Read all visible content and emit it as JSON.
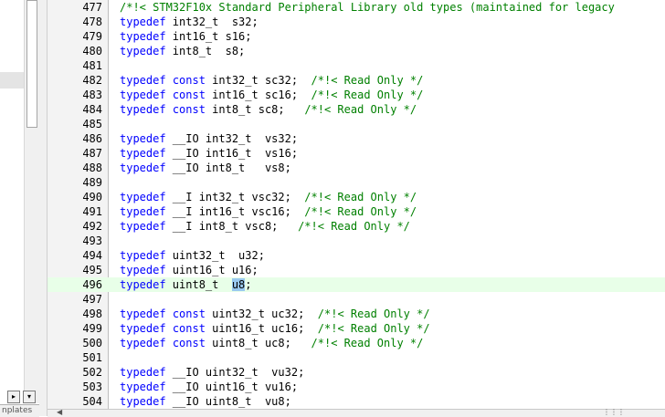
{
  "left_panel": {
    "tab_label": "nplates"
  },
  "editor": {
    "current_line": 496,
    "selected_word": "u8",
    "lines": [
      {
        "n": "477",
        "segs": [
          {
            "c": "cm",
            "t": "/*!< STM32F10x Standard Peripheral Library old types (maintained for legacy"
          }
        ]
      },
      {
        "n": "478",
        "segs": [
          {
            "c": "kw",
            "t": "typedef"
          },
          {
            "c": "",
            "t": " int32_t  s32;"
          }
        ]
      },
      {
        "n": "479",
        "segs": [
          {
            "c": "kw",
            "t": "typedef"
          },
          {
            "c": "",
            "t": " int16_t s16;"
          }
        ]
      },
      {
        "n": "480",
        "segs": [
          {
            "c": "kw",
            "t": "typedef"
          },
          {
            "c": "",
            "t": " int8_t  s8;"
          }
        ]
      },
      {
        "n": "481",
        "segs": []
      },
      {
        "n": "482",
        "segs": [
          {
            "c": "kw",
            "t": "typedef"
          },
          {
            "c": "",
            "t": " "
          },
          {
            "c": "kw",
            "t": "const"
          },
          {
            "c": "",
            "t": " int32_t sc32;  "
          },
          {
            "c": "cm",
            "t": "/*!< Read Only */"
          }
        ]
      },
      {
        "n": "483",
        "segs": [
          {
            "c": "kw",
            "t": "typedef"
          },
          {
            "c": "",
            "t": " "
          },
          {
            "c": "kw",
            "t": "const"
          },
          {
            "c": "",
            "t": " int16_t sc16;  "
          },
          {
            "c": "cm",
            "t": "/*!< Read Only */"
          }
        ]
      },
      {
        "n": "484",
        "segs": [
          {
            "c": "kw",
            "t": "typedef"
          },
          {
            "c": "",
            "t": " "
          },
          {
            "c": "kw",
            "t": "const"
          },
          {
            "c": "",
            "t": " int8_t sc8;   "
          },
          {
            "c": "cm",
            "t": "/*!< Read Only */"
          }
        ]
      },
      {
        "n": "485",
        "segs": []
      },
      {
        "n": "486",
        "segs": [
          {
            "c": "kw",
            "t": "typedef"
          },
          {
            "c": "",
            "t": " __IO int32_t  vs32;"
          }
        ]
      },
      {
        "n": "487",
        "segs": [
          {
            "c": "kw",
            "t": "typedef"
          },
          {
            "c": "",
            "t": " __IO int16_t  vs16;"
          }
        ]
      },
      {
        "n": "488",
        "segs": [
          {
            "c": "kw",
            "t": "typedef"
          },
          {
            "c": "",
            "t": " __IO int8_t   vs8;"
          }
        ]
      },
      {
        "n": "489",
        "segs": []
      },
      {
        "n": "490",
        "segs": [
          {
            "c": "kw",
            "t": "typedef"
          },
          {
            "c": "",
            "t": " __I int32_t vsc32;  "
          },
          {
            "c": "cm",
            "t": "/*!< Read Only */"
          }
        ]
      },
      {
        "n": "491",
        "segs": [
          {
            "c": "kw",
            "t": "typedef"
          },
          {
            "c": "",
            "t": " __I int16_t vsc16;  "
          },
          {
            "c": "cm",
            "t": "/*!< Read Only */"
          }
        ]
      },
      {
        "n": "492",
        "segs": [
          {
            "c": "kw",
            "t": "typedef"
          },
          {
            "c": "",
            "t": " __I int8_t vsc8;   "
          },
          {
            "c": "cm",
            "t": "/*!< Read Only */"
          }
        ]
      },
      {
        "n": "493",
        "segs": []
      },
      {
        "n": "494",
        "segs": [
          {
            "c": "kw",
            "t": "typedef"
          },
          {
            "c": "",
            "t": " uint32_t  u32;"
          }
        ]
      },
      {
        "n": "495",
        "segs": [
          {
            "c": "kw",
            "t": "typedef"
          },
          {
            "c": "",
            "t": " uint16_t u16;"
          }
        ]
      },
      {
        "n": "496",
        "segs": [
          {
            "c": "kw",
            "t": "typedef"
          },
          {
            "c": "",
            "t": " uint8_t  "
          },
          {
            "c": "hl",
            "t": "u8"
          },
          {
            "c": "",
            "t": ";"
          }
        ]
      },
      {
        "n": "497",
        "segs": []
      },
      {
        "n": "498",
        "segs": [
          {
            "c": "kw",
            "t": "typedef"
          },
          {
            "c": "",
            "t": " "
          },
          {
            "c": "kw",
            "t": "const"
          },
          {
            "c": "",
            "t": " uint32_t uc32;  "
          },
          {
            "c": "cm",
            "t": "/*!< Read Only */"
          }
        ]
      },
      {
        "n": "499",
        "segs": [
          {
            "c": "kw",
            "t": "typedef"
          },
          {
            "c": "",
            "t": " "
          },
          {
            "c": "kw",
            "t": "const"
          },
          {
            "c": "",
            "t": " uint16_t uc16;  "
          },
          {
            "c": "cm",
            "t": "/*!< Read Only */"
          }
        ]
      },
      {
        "n": "500",
        "segs": [
          {
            "c": "kw",
            "t": "typedef"
          },
          {
            "c": "",
            "t": " "
          },
          {
            "c": "kw",
            "t": "const"
          },
          {
            "c": "",
            "t": " uint8_t uc8;   "
          },
          {
            "c": "cm",
            "t": "/*!< Read Only */"
          }
        ]
      },
      {
        "n": "501",
        "segs": []
      },
      {
        "n": "502",
        "segs": [
          {
            "c": "kw",
            "t": "typedef"
          },
          {
            "c": "",
            "t": " __IO uint32_t  vu32;"
          }
        ]
      },
      {
        "n": "503",
        "segs": [
          {
            "c": "kw",
            "t": "typedef"
          },
          {
            "c": "",
            "t": " __IO uint16_t vu16;"
          }
        ]
      },
      {
        "n": "504",
        "segs": [
          {
            "c": "kw",
            "t": "typedef"
          },
          {
            "c": "",
            "t": " __IO uint8_t  vu8;"
          }
        ]
      }
    ]
  },
  "colors": {
    "keyword": "#0000ff",
    "comment": "#008000",
    "current_line_bg": "#e8ffe8",
    "selection_bg": "#99c9ef"
  }
}
